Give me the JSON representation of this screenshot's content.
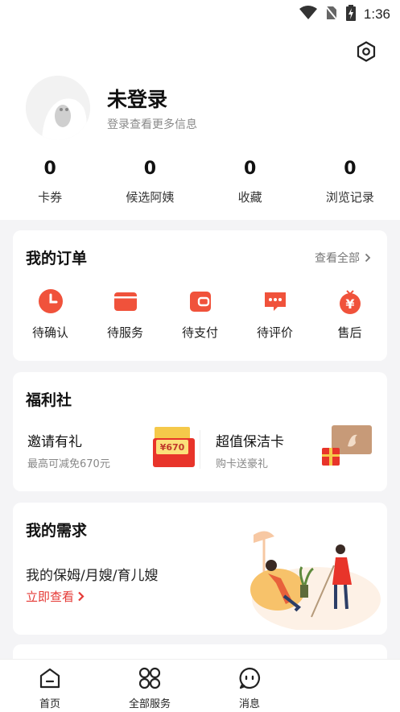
{
  "status_bar": {
    "time": "1:36"
  },
  "profile": {
    "name": "未登录",
    "subtitle": "登录查看更多信息"
  },
  "stats": [
    {
      "value": "0",
      "label": "卡券"
    },
    {
      "value": "0",
      "label": "候选阿姨"
    },
    {
      "value": "0",
      "label": "收藏"
    },
    {
      "value": "0",
      "label": "浏览记录"
    }
  ],
  "orders": {
    "title": "我的订单",
    "view_all": "查看全部",
    "items": [
      {
        "label": "待确认",
        "icon": "clock-icon"
      },
      {
        "label": "待服务",
        "icon": "card-icon"
      },
      {
        "label": "待支付",
        "icon": "wallet-icon"
      },
      {
        "label": "待评价",
        "icon": "comment-icon"
      },
      {
        "label": "售后",
        "icon": "yen-icon"
      }
    ]
  },
  "welfare": {
    "title": "福利社",
    "invite": {
      "title": "邀请有礼",
      "subtitle": "最高可减免670元",
      "badge": "¥670"
    },
    "clean_card": {
      "title": "超值保洁卡",
      "subtitle": "购卡送豪礼"
    }
  },
  "needs": {
    "title": "我的需求",
    "text": "我的保姆/月嫂/育儿嫂",
    "link": "立即查看"
  },
  "tabs": [
    {
      "label": "首页",
      "icon": "home-icon"
    },
    {
      "label": "全部服务",
      "icon": "grid-icon"
    },
    {
      "label": "消息",
      "icon": "message-icon"
    }
  ],
  "colors": {
    "accent": "#f0523b",
    "link": "#e53935"
  }
}
